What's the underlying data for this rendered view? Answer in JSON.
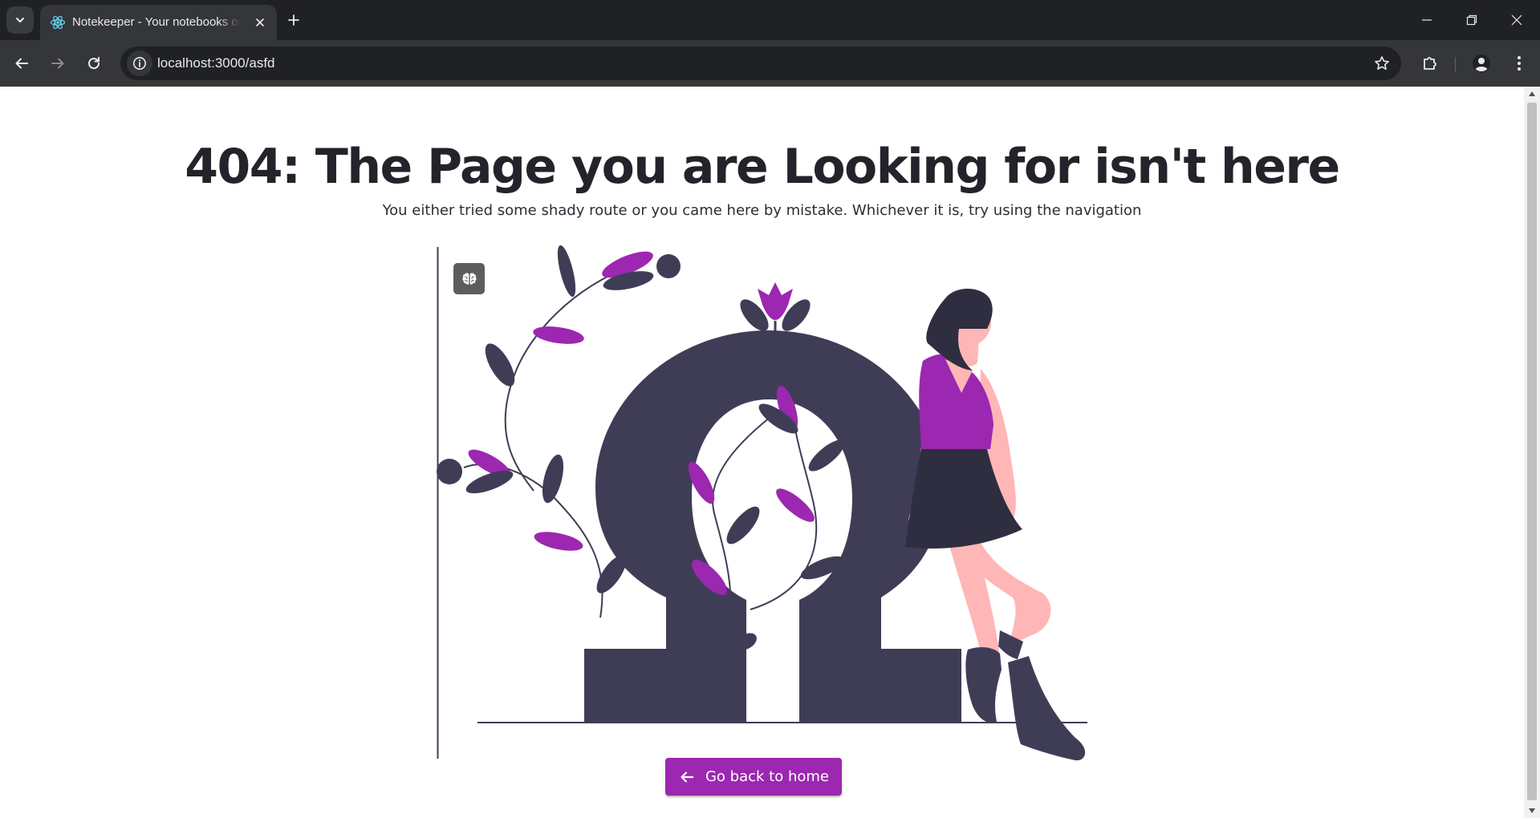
{
  "browser": {
    "tab": {
      "title": "Notekeeper - Your notebooks online",
      "favicon": "react-logo-icon"
    },
    "address_bar": {
      "url": "localhost:3000/asfd"
    },
    "icons": {
      "tab_search": "chevron-down-icon",
      "close_tab": "close-icon",
      "new_tab": "plus-icon",
      "back": "arrow-left-icon",
      "forward": "arrow-right-icon",
      "reload": "reload-icon",
      "site_info": "info-icon",
      "bookmark": "star-icon",
      "extensions": "puzzle-icon",
      "profile": "person-icon",
      "menu": "more-vert-icon",
      "minimize": "minimize-icon",
      "restore": "restore-icon",
      "close_window": "close-icon"
    }
  },
  "page": {
    "heading": "404: The Page you are Looking for isn't here",
    "subtitle": "You either tried some shady route or you came here by mistake. Whichever it is, try using the navigation",
    "illustration": {
      "subject": "woman leaning on omega symbol with leafy vines"
    },
    "badge_icon": "brain-icon",
    "home_button": {
      "label": "Go back to home",
      "icon": "arrow-left-icon"
    }
  },
  "colors": {
    "accent": "#9c27b0",
    "illustration_dark": "#3f3d56",
    "skin": "#ffb6b6",
    "heading": "#23232b",
    "chrome_dark": "#202124",
    "chrome_mid": "#35363a"
  }
}
